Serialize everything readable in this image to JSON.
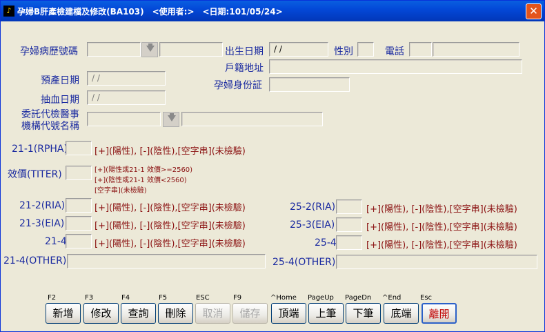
{
  "window": {
    "title": "孕婦B肝產檢建檔及修改(BA103)　<使用者:>　<日期:101/05/24>",
    "close_glyph": "✕"
  },
  "form": {
    "record_no_label": "孕婦病歷號碼",
    "birth_date_label": "出生日期",
    "birth_date_value": "/ /",
    "gender_label": "性別",
    "phone_label": "電話",
    "address_label": "戶籍地址",
    "due_date_label": "預產日期",
    "due_date_value": "/ /",
    "id_label": "孕婦身份証",
    "blood_date_label": "抽血日期",
    "blood_date_value": "/ /",
    "agency_label_line1": "委託代檢醫事",
    "agency_label_line2": "機構代號名稱"
  },
  "tests": {
    "rpha_label": "21-1(RPHA)",
    "titer_label": "效價(TITER)",
    "ria_label": "21-2(RIA)",
    "eia_label": "21-3(EIA)",
    "t214_label": "21-4",
    "t214_other_label": "21-4(OTHER)",
    "ria25_label": "25-2(RIA)",
    "eia25_label": "25-3(EIA)",
    "t254_label": "25-4",
    "t254_other_label": "25-4(OTHER)",
    "result_hint": "[+](陽性), [-](陰性),[空字串](未檢驗)",
    "titer_hint1": "[+](陽性或21-1 效價>=2560)",
    "titer_hint2": "[+](陰性或21-1 效價<2560)",
    "titer_hint3": "[空字串](未檢驗)"
  },
  "toolbar": {
    "buttons": [
      {
        "key": "F2",
        "label": "新增"
      },
      {
        "key": "F3",
        "label": "修改"
      },
      {
        "key": "F4",
        "label": "查詢"
      },
      {
        "key": "F5",
        "label": "刪除"
      },
      {
        "key": "ESC",
        "label": "取消"
      },
      {
        "key": "F9",
        "label": "儲存"
      },
      {
        "key": "^Home",
        "label": "頂端"
      },
      {
        "key": "PageUp",
        "label": "上筆"
      },
      {
        "key": "PageDn",
        "label": "下筆"
      },
      {
        "key": "^End",
        "label": "底端"
      },
      {
        "key": "Esc",
        "label": "離開"
      }
    ]
  }
}
